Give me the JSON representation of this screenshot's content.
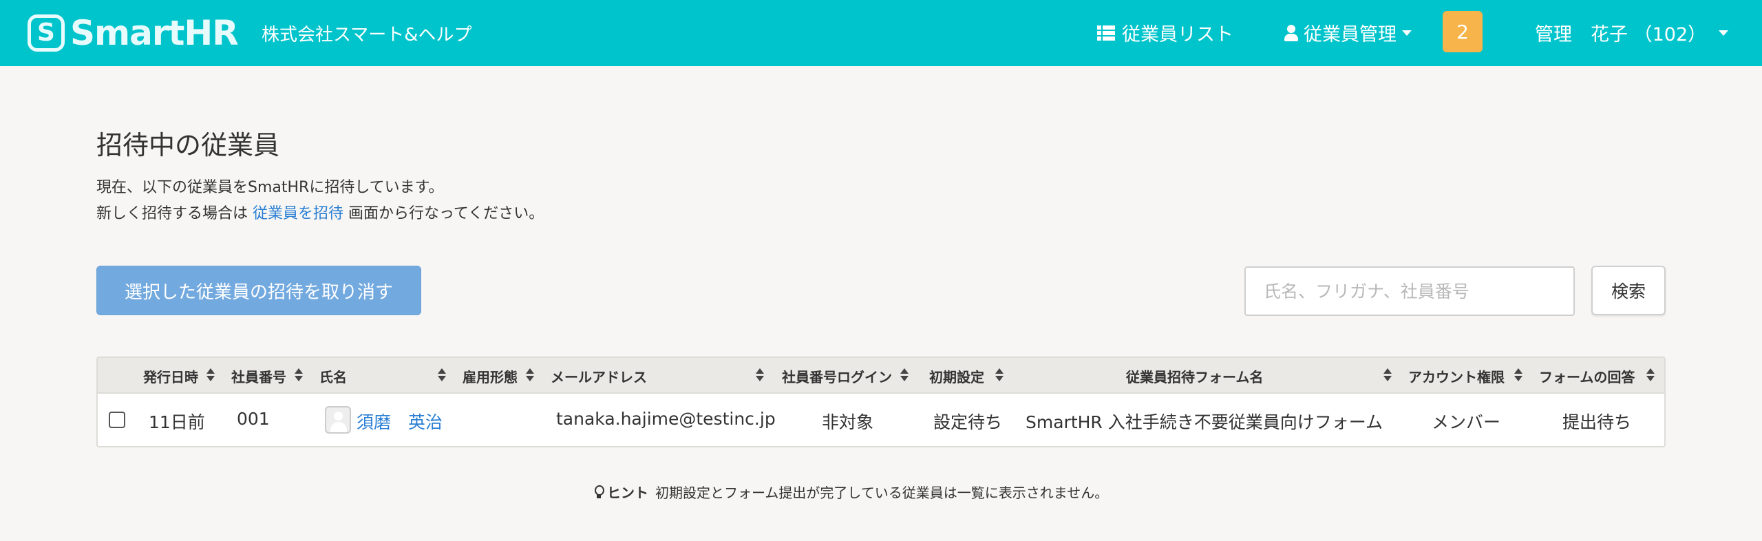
{
  "header": {
    "logo_mark": "S",
    "logo_text": "SmartHR",
    "company": "株式会社スマート&ヘルプ",
    "nav_employee_list": "従業員リスト",
    "nav_employee_manage": "従業員管理",
    "notification_count": "2",
    "user_name": "管理　花子 （102）",
    "colors": {
      "bar": "#00c4cc",
      "badge": "#f7b44a"
    }
  },
  "main": {
    "title": "招待中の従業員",
    "desc_line1": "現在、以下の従業員をSmatHRに招待しています。",
    "desc_line2_before": "新しく招待する場合は",
    "desc_line2_link": "従業員を招待",
    "desc_line2_after": "画面から行なってください。",
    "cancel_button": "選択した従業員の招待を取り消す",
    "search_placeholder": "氏名、フリガナ、社員番号",
    "search_button": "検索"
  },
  "table": {
    "columns": [
      "発行日時",
      "社員番号",
      "氏名",
      "雇用形態",
      "メールアドレス",
      "社員番号ログイン",
      "初期設定",
      "従業員招待フォーム名",
      "アカウント権限",
      "フォームの回答"
    ],
    "rows": [
      {
        "issued": "11日前",
        "employee_no": "001",
        "name": "須磨　英治",
        "employment": "",
        "email": "tanaka.hajime@testinc.jp",
        "number_login": "非対象",
        "initial_setup": "設定待ち",
        "form_name": "SmartHR 入社手続き不要従業員向けフォーム",
        "account_role": "メンバー",
        "form_answer": "提出待ち"
      }
    ]
  },
  "hint": {
    "label": "ヒント",
    "text": "初期設定とフォーム提出が完了している従業員は一覧に表示されません。"
  }
}
